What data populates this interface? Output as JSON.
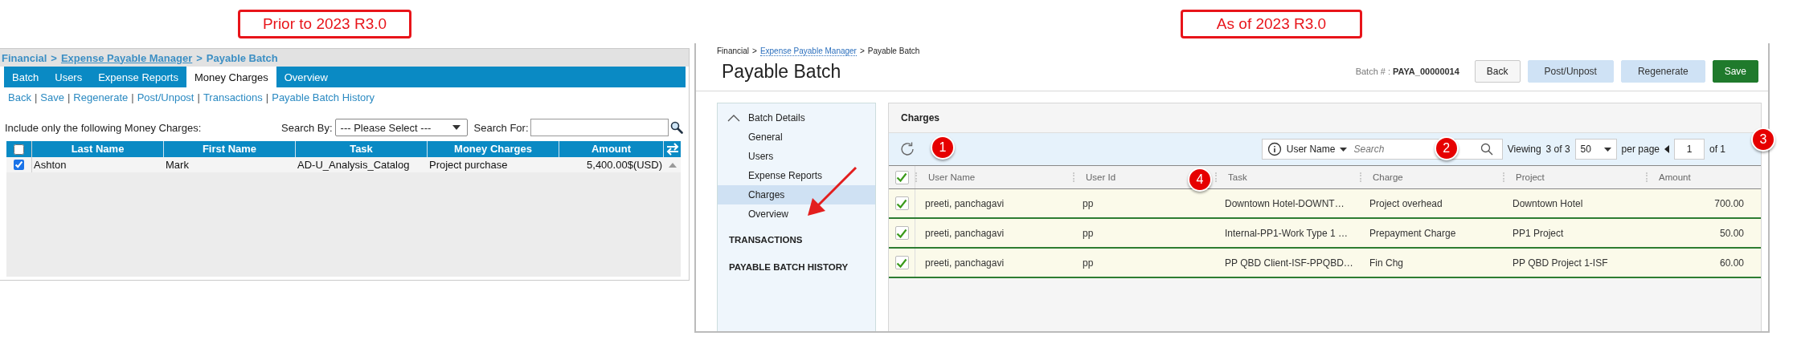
{
  "old_version": {
    "label": "Prior to 2023 R3.0",
    "breadcrumb": {
      "separator": ">",
      "items": [
        {
          "text": "Financial",
          "link": false
        },
        {
          "text": "Expense Payable Manager",
          "link": true
        },
        {
          "text": "Payable Batch",
          "link": false
        }
      ]
    },
    "tabs": [
      {
        "label": "Batch",
        "selected": false
      },
      {
        "label": "Users",
        "selected": false
      },
      {
        "label": "Expense Reports",
        "selected": false
      },
      {
        "label": "Money Charges",
        "selected": true
      },
      {
        "label": "Overview",
        "selected": false
      }
    ],
    "actions": {
      "separator": "|",
      "items": [
        "Back",
        "Save",
        "Regenerate",
        "Post/Unpost",
        "Transactions",
        "Payable Batch History"
      ]
    },
    "filter": {
      "label": "Include only the following Money Charges:",
      "search_by_label": "Search By:",
      "search_by_value": "--- Please Select ---",
      "search_for_label": "Search For:"
    },
    "table": {
      "select_all_checked": false,
      "columns": [
        "Last Name",
        "First Name",
        "Task",
        "Money Charges",
        "Amount"
      ],
      "rows": [
        {
          "checked": true,
          "cells": [
            "Ashton",
            "Mark",
            "AD-U_Analysis_Catalog",
            "Project purchase",
            "5,400.00$(USD)"
          ]
        }
      ]
    }
  },
  "new_version": {
    "label": "As of 2023 R3.0",
    "breadcrumb": {
      "separator": ">",
      "items": [
        {
          "text": "Financial",
          "link": false
        },
        {
          "text": "Expense Payable Manager",
          "link": true
        },
        {
          "text": "Payable Batch",
          "link": false
        }
      ]
    },
    "title": "Payable Batch",
    "batch_label": "Batch # :",
    "batch_number": "PAYA_00000014",
    "buttons": [
      {
        "label": "Back",
        "kind": "default"
      },
      {
        "label": "Post/Unpost",
        "kind": "secondary"
      },
      {
        "label": "Regenerate",
        "kind": "secondary"
      },
      {
        "label": "Save",
        "kind": "primary"
      }
    ],
    "sidebar": {
      "section": {
        "label": "Batch Details",
        "expanded": true,
        "items": [
          {
            "label": "General",
            "selected": false
          },
          {
            "label": "Users",
            "selected": false
          },
          {
            "label": "Expense Reports",
            "selected": false
          },
          {
            "label": "Charges",
            "selected": true
          },
          {
            "label": "Overview",
            "selected": false
          }
        ]
      },
      "links": [
        "TRANSACTIONS",
        "PAYABLE BATCH HISTORY"
      ]
    },
    "panel_title": "Charges",
    "toolbar": {
      "search_by": "User Name",
      "search_placeholder": "Search",
      "viewing": "Viewing",
      "viewing_count": "3 of 3",
      "page_size": "50",
      "per_page": "per page",
      "page": "1",
      "of_pages": "of 1"
    },
    "table": {
      "select_all_checked": true,
      "columns": [
        "User Name",
        "User Id",
        "Task",
        "Charge",
        "Project",
        "Amount"
      ],
      "rows": [
        {
          "checked": true,
          "cells": [
            "preeti, panchagavi",
            "pp",
            "Downtown Hotel-DOWNT…",
            "Project overhead",
            "Downtown Hotel",
            "700.00"
          ]
        },
        {
          "checked": true,
          "cells": [
            "preeti, panchagavi",
            "pp",
            "Internal-PP1-Work Type 1 …",
            "Prepayment Charge",
            "PP1 Project",
            "50.00"
          ]
        },
        {
          "checked": true,
          "cells": [
            "preeti, panchagavi",
            "pp",
            "PP QBD Client-ISF-PPQBD…",
            "Fin Chg",
            "PP QBD Project 1-ISF",
            "60.00"
          ]
        }
      ]
    },
    "annotations": [
      "1",
      "2",
      "3",
      "4"
    ]
  }
}
